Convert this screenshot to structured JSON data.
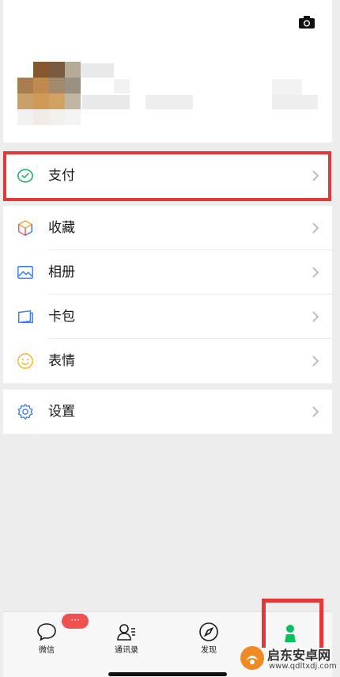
{
  "profile": {
    "camera_icon": "camera-icon",
    "avatar_colors": [
      [
        "#ffffff",
        "#86572f",
        "#7a5a3f",
        "#b8aa98"
      ],
      [
        "#a97c50",
        "#c08a4f",
        "#a1896d",
        "#9b9182"
      ],
      [
        "#c7a06c",
        "#cf9a57",
        "#d0a160",
        "#c2b6a2"
      ],
      [
        "#f1f1f1",
        "#f0ebe5",
        "#f3efea",
        "#f4f4f4"
      ]
    ]
  },
  "menu": {
    "pay": {
      "label": "支付",
      "icon": "wechat-pay-icon"
    },
    "favorites": {
      "label": "收藏",
      "icon": "favorites-cube-icon"
    },
    "album": {
      "label": "相册",
      "icon": "album-photo-icon"
    },
    "cards": {
      "label": "卡包",
      "icon": "card-wallet-icon"
    },
    "stickers": {
      "label": "表情",
      "icon": "sticker-smile-icon"
    },
    "settings": {
      "label": "设置",
      "icon": "settings-gear-icon"
    }
  },
  "tabbar": {
    "tabs": [
      {
        "label": "微信",
        "icon": "chat-bubble-icon",
        "badge": "···"
      },
      {
        "label": "通讯录",
        "icon": "contacts-icon"
      },
      {
        "label": "发现",
        "icon": "compass-icon"
      },
      {
        "label": "",
        "icon": "me-person-icon",
        "active": true
      }
    ]
  },
  "watermark": {
    "title": "启东安卓网",
    "url": "www.qdltxdj.com"
  },
  "colors": {
    "highlight": "#e23838",
    "pay_green": "#26b368",
    "settings_blue": "#3b7cf0",
    "me_green": "#07c160",
    "badge_red": "#f05050"
  }
}
